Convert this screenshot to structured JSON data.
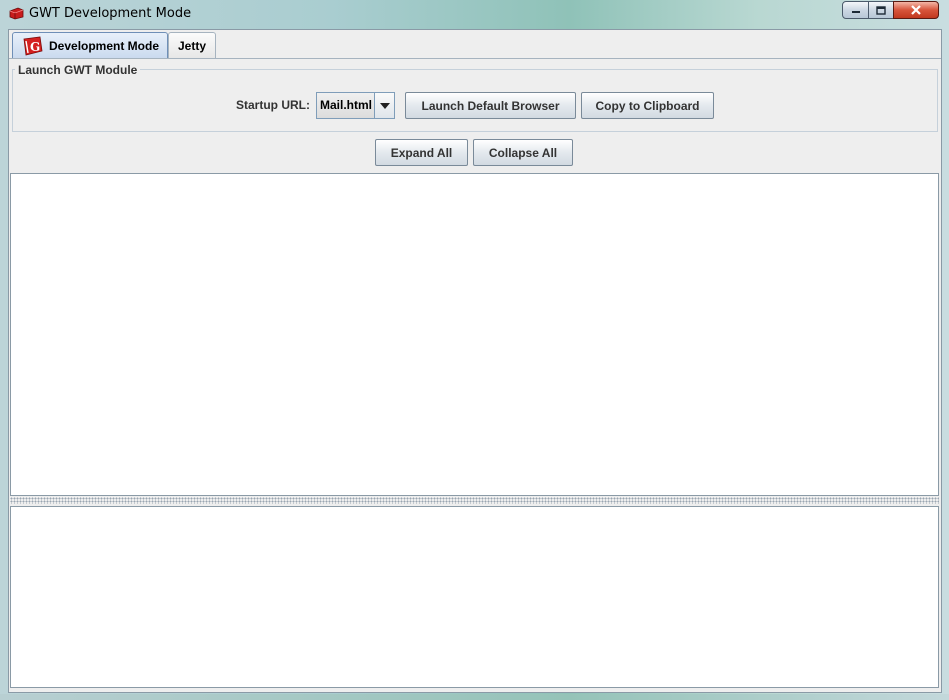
{
  "window": {
    "title": "GWT Development Mode",
    "app_icon": "gwt-toolbox-icon"
  },
  "tabs": [
    {
      "label": "Development Mode",
      "icon": "gwt-logo-icon",
      "selected": true
    },
    {
      "label": "Jetty",
      "selected": false
    }
  ],
  "launch_group": {
    "title": "Launch GWT Module",
    "startup_url_label": "Startup URL:",
    "startup_url_value": "Mail.html",
    "launch_button": "Launch Default Browser",
    "copy_button": "Copy to Clipboard"
  },
  "tree_controls": {
    "expand_all": "Expand All",
    "collapse_all": "Collapse All"
  },
  "colors": {
    "accent": "#6f8fb7",
    "panel_bg": "#eeeeee",
    "gwt_red": "#d42020"
  }
}
